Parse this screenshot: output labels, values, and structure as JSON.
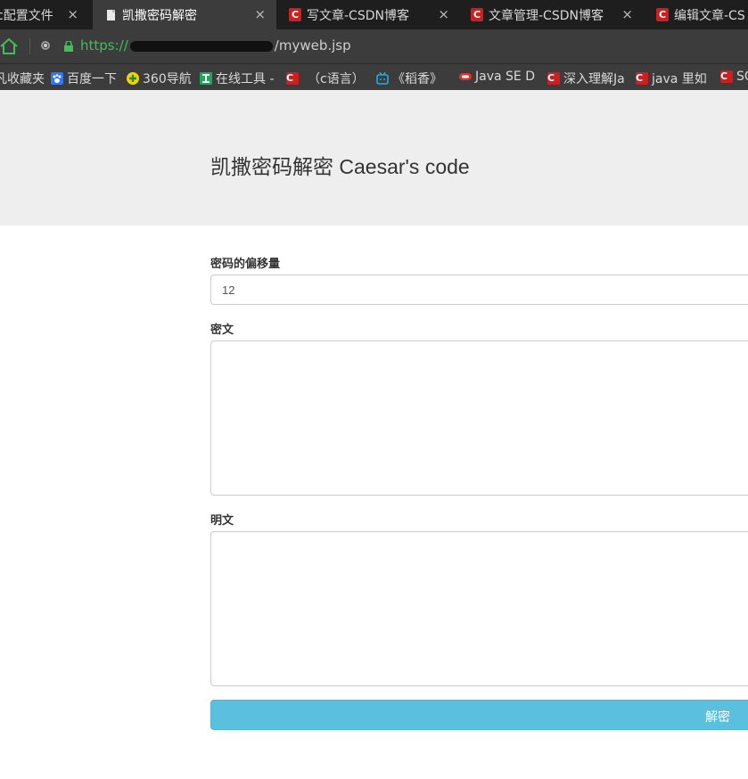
{
  "tabs": [
    {
      "title": "c配置文件",
      "active": false,
      "icon": "none"
    },
    {
      "title": "凯撒密码解密",
      "active": true,
      "icon": "document-icon"
    },
    {
      "title": "写文章-CSDN博客",
      "active": false,
      "icon": "csdn-icon"
    },
    {
      "title": "文章管理-CSDN博客",
      "active": false,
      "icon": "csdn-icon"
    },
    {
      "title": "编辑文章-CS",
      "active": false,
      "icon": "csdn-icon"
    }
  ],
  "tab_close_glyph": "×",
  "address": {
    "scheme": "https://",
    "path": "/myweb.jsp"
  },
  "bookmarks": [
    {
      "label": "凡收藏夹",
      "icon": "none"
    },
    {
      "label": "百度一下",
      "icon": "baidu-paw-icon"
    },
    {
      "label": "360导航",
      "icon": "360-icon"
    },
    {
      "label": "在线工具 -",
      "icon": "tool-icon"
    },
    {
      "label": "（c语言）",
      "icon": "csdn-icon"
    },
    {
      "label": "《稻香》",
      "icon": "bilibili-icon"
    },
    {
      "label": "Java SE D",
      "icon": "oracle-icon"
    },
    {
      "label": "深入理解Ja",
      "icon": "csdn-icon"
    },
    {
      "label": "java 里如",
      "icon": "csdn-icon"
    },
    {
      "label": "SC",
      "icon": "csdn-icon"
    }
  ],
  "page": {
    "title": "凯撒密码解密 Caesar's code",
    "offset_label": "密码的偏移量",
    "offset_value": "12",
    "ciphertext_label": "密文",
    "ciphertext_value": "",
    "plaintext_label": "明文",
    "plaintext_value": "",
    "submit_label": "解密"
  },
  "colors": {
    "tab_bg": "#1e1e1e",
    "toolbar_bg": "#3c3c3c",
    "url_scheme": "#3fbf55",
    "jumbotron_bg": "#eeeeee",
    "button_bg": "#5bc0de",
    "csdn_red": "#cc1f1f"
  }
}
